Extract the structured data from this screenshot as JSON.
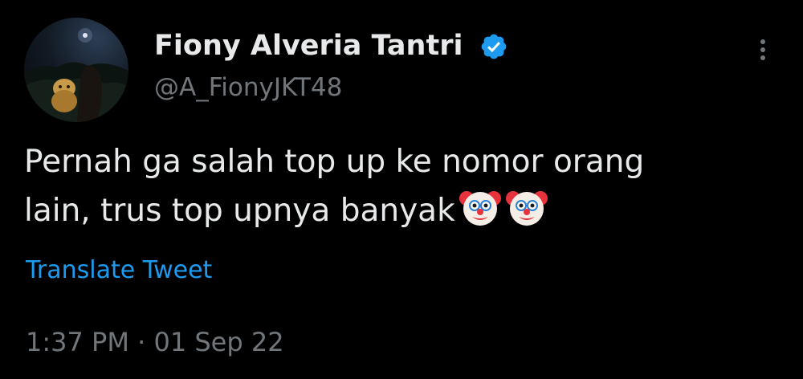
{
  "tweet": {
    "author": {
      "display_name": "Fiony Alveria Tantri",
      "handle": "@A_FionyJKT48",
      "verified": true,
      "avatar_icon": "profile-photo"
    },
    "text_lines": [
      "Pernah ga salah top up ke nomor orang",
      "lain, trus top upnya banyak"
    ],
    "emojis": [
      "clown-face-icon",
      "clown-face-icon"
    ],
    "translate_label": "Translate Tweet",
    "timestamp": "1:37 PM · 01 Sep 22",
    "more_icon": "more-vertical-icon"
  },
  "colors": {
    "background": "#000000",
    "primary_text": "#e7e9ea",
    "secondary_text": "#71767b",
    "link": "#1d9bf0",
    "verified_badge": "#1d9bf0"
  }
}
